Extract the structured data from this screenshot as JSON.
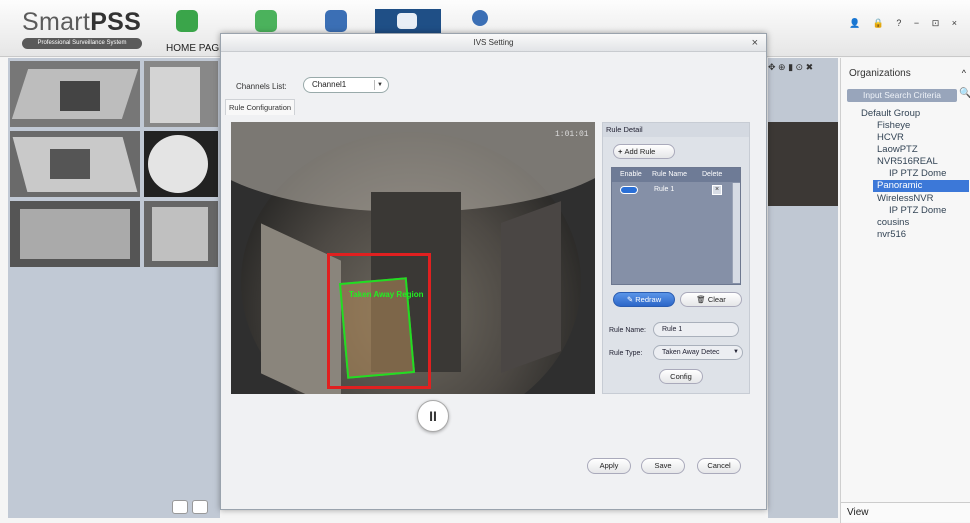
{
  "app": {
    "logo_main": "Smart",
    "logo_bold": "PSS",
    "logo_sub": "Professional Surveillance System",
    "home_tab": "HOME PAGE",
    "window_controls": "👤 🔒 ? − ⊡ ×"
  },
  "dialog": {
    "title": "IVS Setting",
    "close": "×",
    "channels_label": "Channels List:",
    "channel_value": "Channel1",
    "tab_rule_config": "Rule Configuration",
    "pause": "II",
    "apply": "Apply",
    "save": "Save",
    "cancel": "Cancel"
  },
  "video": {
    "timestamp": "1:01:01",
    "rule_overlay_label": "Taken Away Region"
  },
  "rule_detail": {
    "title": "Rule Detail",
    "add_rule": "Add Rule",
    "headers": [
      "Enable",
      "Rule Name",
      "Delete"
    ],
    "rows": [
      {
        "name": "Rule 1",
        "enabled": true
      }
    ],
    "redraw": "Redraw",
    "clear": "Clear",
    "rule_name_label": "Rule Name:",
    "rule_name_value": "Rule 1",
    "rule_type_label": "Rule Type:",
    "rule_type_value": "Taken Away Detec",
    "config": "Config"
  },
  "organizations": {
    "title": "Organizations",
    "search_placeholder": "Input Search Criteria",
    "tree": [
      {
        "label": "Default Group",
        "level": 0
      },
      {
        "label": "Fisheye",
        "level": 1
      },
      {
        "label": "HCVR",
        "level": 1
      },
      {
        "label": "LaowPTZ",
        "level": 1
      },
      {
        "label": "NVR516REAL",
        "level": 1
      },
      {
        "label": "IP PTZ Dome",
        "level": 2
      },
      {
        "label": "Panoramic",
        "level": 1,
        "selected": true
      },
      {
        "label": "WirelessNVR",
        "level": 1
      },
      {
        "label": "IP PTZ Dome",
        "level": 2
      },
      {
        "label": "cousins",
        "level": 1
      },
      {
        "label": "nvr516",
        "level": 1
      }
    ],
    "view_label": "View"
  },
  "colors": {
    "accent": "#1f4f86",
    "selected": "#3c78d8",
    "rule_box": "#e02020",
    "region": "#22dd22"
  }
}
